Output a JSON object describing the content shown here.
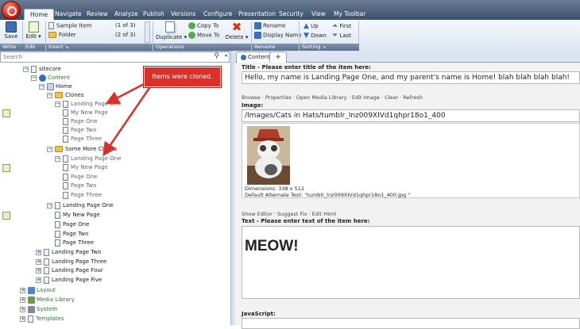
{
  "menubar": {
    "tabs": [
      "Home",
      "Navigate",
      "Review",
      "Analyze",
      "Publish",
      "Versions",
      "Configure",
      "Presentation",
      "Security",
      "View",
      "My Toolbar"
    ]
  },
  "ribbon": {
    "save": "Save",
    "edit": "Edit",
    "insert_items": [
      {
        "label": "Sample Item",
        "count": "(1 of 3)"
      },
      {
        "label": "Folder",
        "count": "(2 of 3)"
      }
    ],
    "duplicate": "Duplicate",
    "copy_to": "Copy To",
    "move_to": "Move To",
    "delete": "Delete",
    "rename": "Rename",
    "display_name": "Display Name",
    "up": "Up",
    "down": "Down",
    "first": "First",
    "last": "Last",
    "groups": [
      "Write",
      "Edit",
      "Insert",
      "Operations",
      "Rename",
      "Sorting"
    ]
  },
  "search": {
    "placeholder": "Search"
  },
  "tree": {
    "sitecore": "sitecore",
    "content": "Content",
    "home": "Home",
    "clones": "Clones",
    "lp1": "Landing Page One",
    "my_new_page": "My New Page",
    "page_one": "Page One",
    "page_two": "Page Two",
    "page_three": "Page Three",
    "some_more_clones": "Some More Clones",
    "lp2": "Landing Page Two",
    "lp3": "Landing Page Three",
    "lp4": "Landing Page Four",
    "lp5": "Landing Page Five",
    "layout": "Layout",
    "media_library": "Media Library",
    "system": "System",
    "templates": "Templates"
  },
  "callout": "Items were cloned.",
  "content_tab": "Content",
  "editor": {
    "title_label": "Title - Please enter title of the item here:",
    "title_value": "Hello, my name is Landing Page One, and my parent's name is Home! blah blah blah blah!",
    "image_links": "Browse · Properties · Open Media Library · Edit Image · Clear · Refresh",
    "image_label": "Image:",
    "image_path": "/Images/Cats in Hats/tumblr_lnz009XIVd1qhpr18o1_400",
    "dimensions": "Dimensions: 338 x 512",
    "alt_text": "Default Alternate Text: \"tumblr_lnz009XIVd1qhpr18o1_400.jpg \"",
    "text_links": "Show Editor · Suggest Fix · Edit Html",
    "text_label": "Text - Please enter text of the item here:",
    "text_value": "MEOW!",
    "js_label": "JavaScript:"
  }
}
